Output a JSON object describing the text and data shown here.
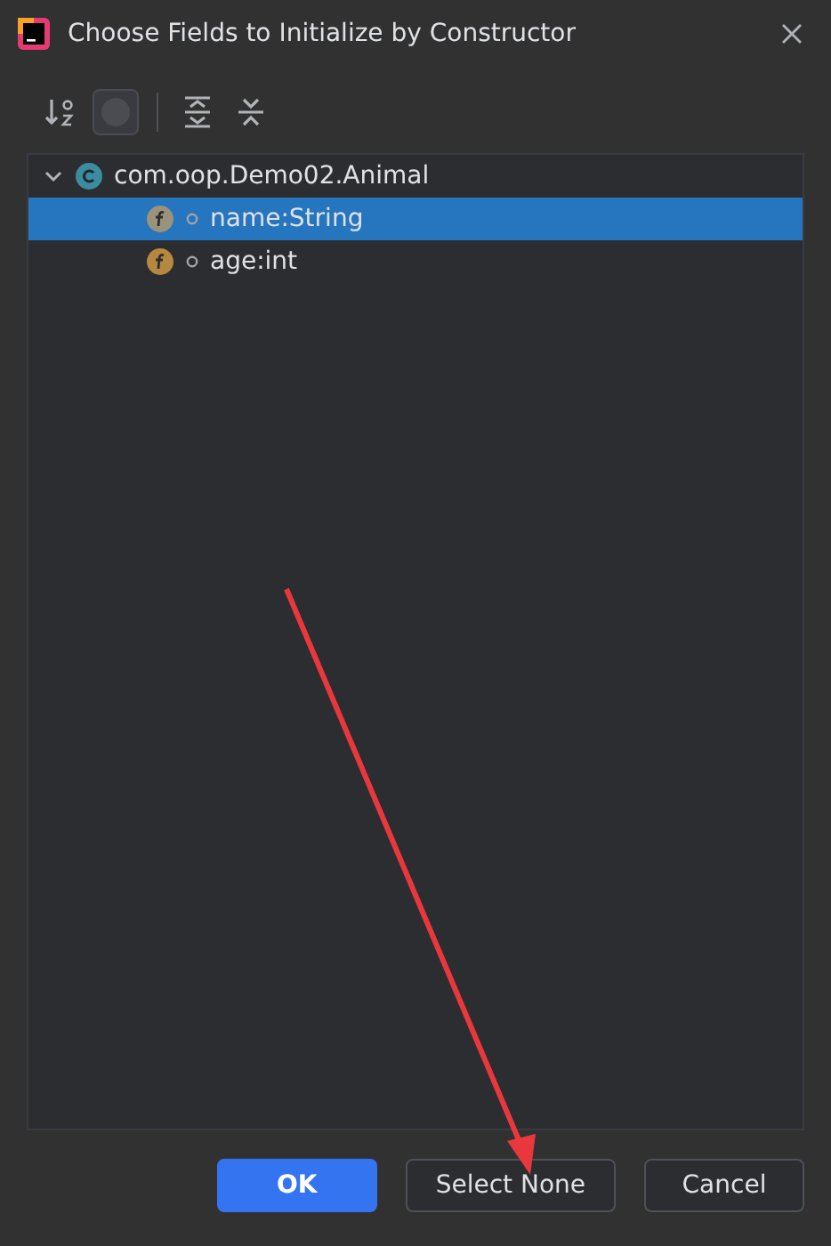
{
  "window": {
    "title": "Choose Fields to Initialize by Constructor"
  },
  "tree": [
    {
      "label": "com.oop.Demo02.Animal",
      "kind": "class",
      "expanded": true,
      "selected": false,
      "children": [
        {
          "label": "name:String",
          "kind": "field",
          "selected": true,
          "color": "#9b927c"
        },
        {
          "label": "age:int",
          "kind": "field",
          "selected": false,
          "color": "#b5883f"
        }
      ]
    }
  ],
  "buttons": [
    {
      "label": "OK",
      "kind": "primary"
    },
    {
      "label": "Select None",
      "kind": "normal"
    },
    {
      "label": "Cancel",
      "kind": "normal"
    }
  ]
}
